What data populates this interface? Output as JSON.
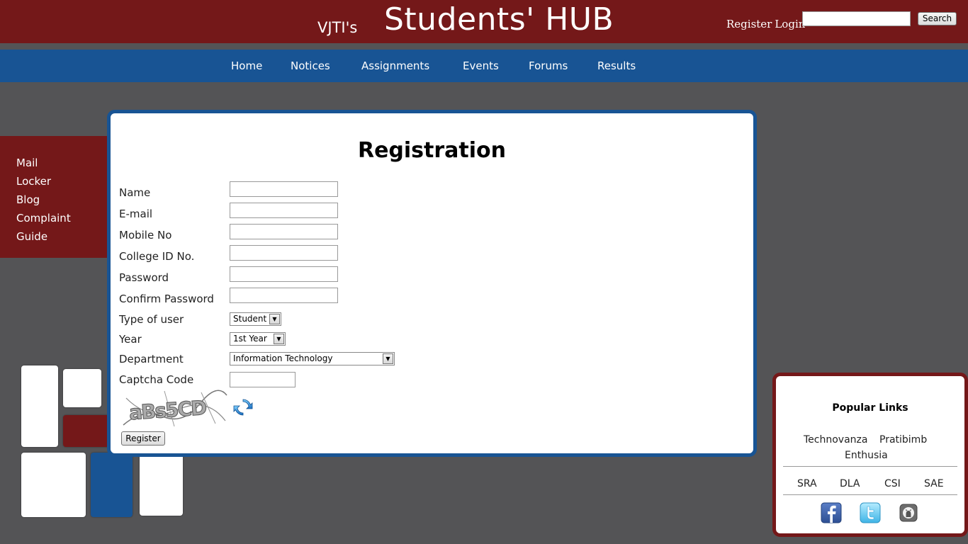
{
  "header": {
    "brand_small": "VJTI's",
    "brand_big": "Students' HUB",
    "register_link": "Register",
    "login_link": "Login",
    "search_button": "Search",
    "search_value": ""
  },
  "nav": {
    "items": [
      "Home",
      "Notices",
      "Assignments",
      "Events",
      "Forums",
      "Results"
    ]
  },
  "side_menu": {
    "items": [
      "Mail",
      "Locker",
      "Blog",
      "Complaint",
      "Guide"
    ]
  },
  "registration": {
    "title": "Registration",
    "fields": {
      "name": {
        "label": "Name",
        "value": ""
      },
      "email": {
        "label": "E-mail",
        "value": ""
      },
      "mobile": {
        "label": "Mobile No",
        "value": ""
      },
      "college_id": {
        "label": "College ID No.",
        "value": ""
      },
      "password": {
        "label": "Password",
        "value": ""
      },
      "confirm_password": {
        "label": "Confirm Password",
        "value": ""
      }
    },
    "user_type": {
      "label": "Type of user",
      "selected": "Student"
    },
    "year": {
      "label": "Year",
      "selected": "1st Year"
    },
    "department": {
      "label": "Department",
      "selected": "Information Technology"
    },
    "captcha": {
      "label": "Captcha Code",
      "value": "",
      "image_text": "aBs5CD"
    },
    "register_button": "Register"
  },
  "popular_links": {
    "title": "Popular Links",
    "festivals": [
      "Technovanza",
      "Pratibimb",
      "Enthusia"
    ],
    "clubs": [
      "SRA",
      "DLA",
      "CSI",
      "SAE"
    ],
    "social_icons": [
      "facebook-icon",
      "twitter-icon",
      "github-icon"
    ]
  },
  "colors": {
    "brand_red": "#741819",
    "brand_blue": "#185494",
    "background": "#545456"
  }
}
